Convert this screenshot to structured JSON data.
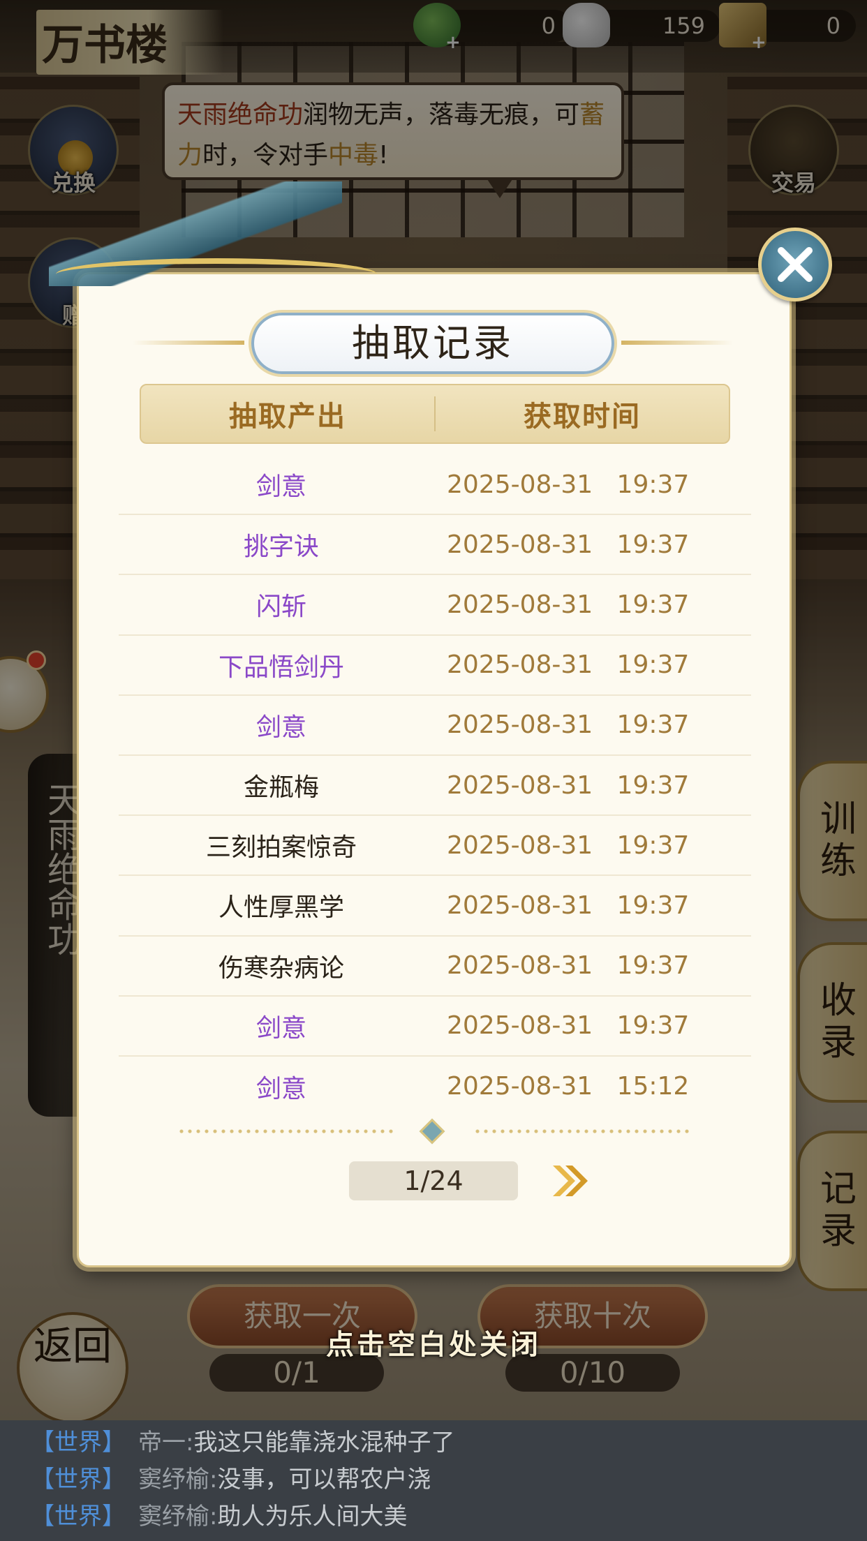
{
  "header": {
    "title": "万书楼",
    "currencies": [
      {
        "icon": "jade-frog-icon",
        "value": "0"
      },
      {
        "icon": "silver-ingot-icon",
        "value": "159"
      },
      {
        "icon": "book-scroll-icon",
        "value": "0"
      }
    ]
  },
  "side_buttons": {
    "exchange": "兑换",
    "trade": "交易",
    "gift": "赠"
  },
  "bubble": {
    "part1": "天雨绝命功",
    "part2": "润物无声，落毒无痕，可",
    "part3": "蓄力",
    "part4": "时，令对手",
    "part5": "中毒",
    "part6": "!"
  },
  "background": {
    "vertical_title": "天雨绝命功"
  },
  "right_tabs": {
    "train": "训练",
    "collect": "收录",
    "record": "记录"
  },
  "actions": {
    "draw_once": "获取一次",
    "draw_ten": "获取十次",
    "once_count": "0/1",
    "ten_count": "0/10",
    "back": "返回"
  },
  "modal": {
    "title": "抽取记录",
    "col_item": "抽取产出",
    "col_time": "获取时间",
    "rows": [
      {
        "item": "剑意",
        "time": "2025-08-31   19:37",
        "color": "#8a48c8"
      },
      {
        "item": "挑字诀",
        "time": "2025-08-31   19:37",
        "color": "#8a48c8"
      },
      {
        "item": "闪斩",
        "time": "2025-08-31   19:37",
        "color": "#8a48c8"
      },
      {
        "item": "下品悟剑丹",
        "time": "2025-08-31   19:37",
        "color": "#8a48c8"
      },
      {
        "item": "剑意",
        "time": "2025-08-31   19:37",
        "color": "#8a48c8"
      },
      {
        "item": "金瓶梅",
        "time": "2025-08-31   19:37",
        "color": "#2a2218"
      },
      {
        "item": "三刻拍案惊奇",
        "time": "2025-08-31   19:37",
        "color": "#2a2218"
      },
      {
        "item": "人性厚黑学",
        "time": "2025-08-31   19:37",
        "color": "#2a2218"
      },
      {
        "item": "伤寒杂病论",
        "time": "2025-08-31   19:37",
        "color": "#2a2218"
      },
      {
        "item": "剑意",
        "time": "2025-08-31   19:37",
        "color": "#8a48c8"
      },
      {
        "item": "剑意",
        "time": "2025-08-31   15:12",
        "color": "#8a48c8"
      }
    ],
    "page": "1/24",
    "close_hint": "点击空白处关闭"
  },
  "chat": [
    {
      "channel": "【世界】",
      "speaker": "帝一:",
      "message": "我这只能靠浇水混种子了"
    },
    {
      "channel": "【世界】",
      "speaker": "窦纾榆:",
      "message": "没事，可以帮农户浇"
    },
    {
      "channel": "【世界】",
      "speaker": "窦纾榆:",
      "message": "助人为乐人间大美"
    }
  ]
}
